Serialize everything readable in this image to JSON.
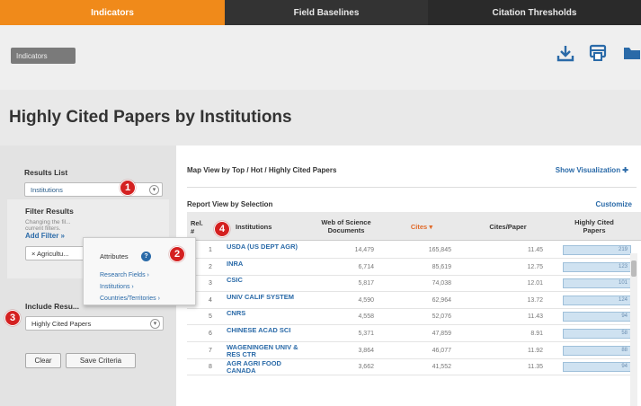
{
  "topnav": {
    "tabs": [
      {
        "label": "Indicators",
        "active": true
      },
      {
        "label": "Field Baselines",
        "active": false
      },
      {
        "label": "Citation Thresholds",
        "active": false
      }
    ]
  },
  "toolbar": {
    "breadcrumb_label": "Indicators",
    "icons": [
      "download-icon",
      "print-icon",
      "folder-icon"
    ]
  },
  "page": {
    "title": "Highly Cited Papers by Institutions"
  },
  "sidebar": {
    "results_list_label": "Results List",
    "results_list_value": "Institutions",
    "filter_results_label": "Filter Results",
    "filter_hint": "Changing the fil... current filters.",
    "add_filter_label": "Add Filter »",
    "active_filter": "× Agricultu...",
    "include_results_label": "Include Resu...",
    "include_value": "Highly Cited Papers",
    "clear_label": "Clear",
    "save_label": "Save Criteria"
  },
  "popup": {
    "heading": "Attributes",
    "info": "?",
    "items": [
      "Research Fields ›",
      "Institutions ›",
      "Countries/Territories ›"
    ]
  },
  "badges": [
    "1",
    "2",
    "3",
    "4"
  ],
  "main": {
    "map_title": "Map View by Top / Hot / Highly Cited Papers",
    "show_vis": "Show Visualization ✚",
    "report_title": "Report View by Selection",
    "customize": "Customize",
    "columns": {
      "rank": "Rel. #",
      "institutions": "Institutions",
      "docs": "Web of Science Documents",
      "cites": "Cites ▾",
      "cpp": "Cites/Paper",
      "hcp": "Highly Cited Papers"
    },
    "rows": [
      {
        "rank": "1",
        "inst": "USDA (US DEPT AGR)",
        "docs": "14,479",
        "cites": "165,845",
        "cpp": "11.45",
        "hcp": "219",
        "hcp_fill": 1.0
      },
      {
        "rank": "2",
        "inst": "INRA",
        "docs": "6,714",
        "cites": "85,619",
        "cpp": "12.75",
        "hcp": "123",
        "hcp_fill": 1.0
      },
      {
        "rank": "3",
        "inst": "CSIC",
        "docs": "5,817",
        "cites": "74,038",
        "cpp": "12.01",
        "hcp": "101",
        "hcp_fill": 1.0
      },
      {
        "rank": "4",
        "inst": "UNIV CALIF SYSTEM",
        "docs": "4,590",
        "cites": "62,964",
        "cpp": "13.72",
        "hcp": "124",
        "hcp_fill": 1.0
      },
      {
        "rank": "5",
        "inst": "CNRS",
        "docs": "4,558",
        "cites": "52,076",
        "cpp": "11.43",
        "hcp": "94",
        "hcp_fill": 1.0
      },
      {
        "rank": "6",
        "inst": "CHINESE ACAD SCI",
        "docs": "5,371",
        "cites": "47,859",
        "cpp": "8.91",
        "hcp": "58",
        "hcp_fill": 1.0
      },
      {
        "rank": "7",
        "inst": "WAGENINGEN UNIV & RES CTR",
        "docs": "3,864",
        "cites": "46,077",
        "cpp": "11.92",
        "hcp": "88",
        "hcp_fill": 1.0
      },
      {
        "rank": "8",
        "inst": "AGR AGRI FOOD CANADA",
        "docs": "3,662",
        "cites": "41,552",
        "cpp": "11.35",
        "hcp": "94",
        "hcp_fill": 1.0
      }
    ]
  }
}
